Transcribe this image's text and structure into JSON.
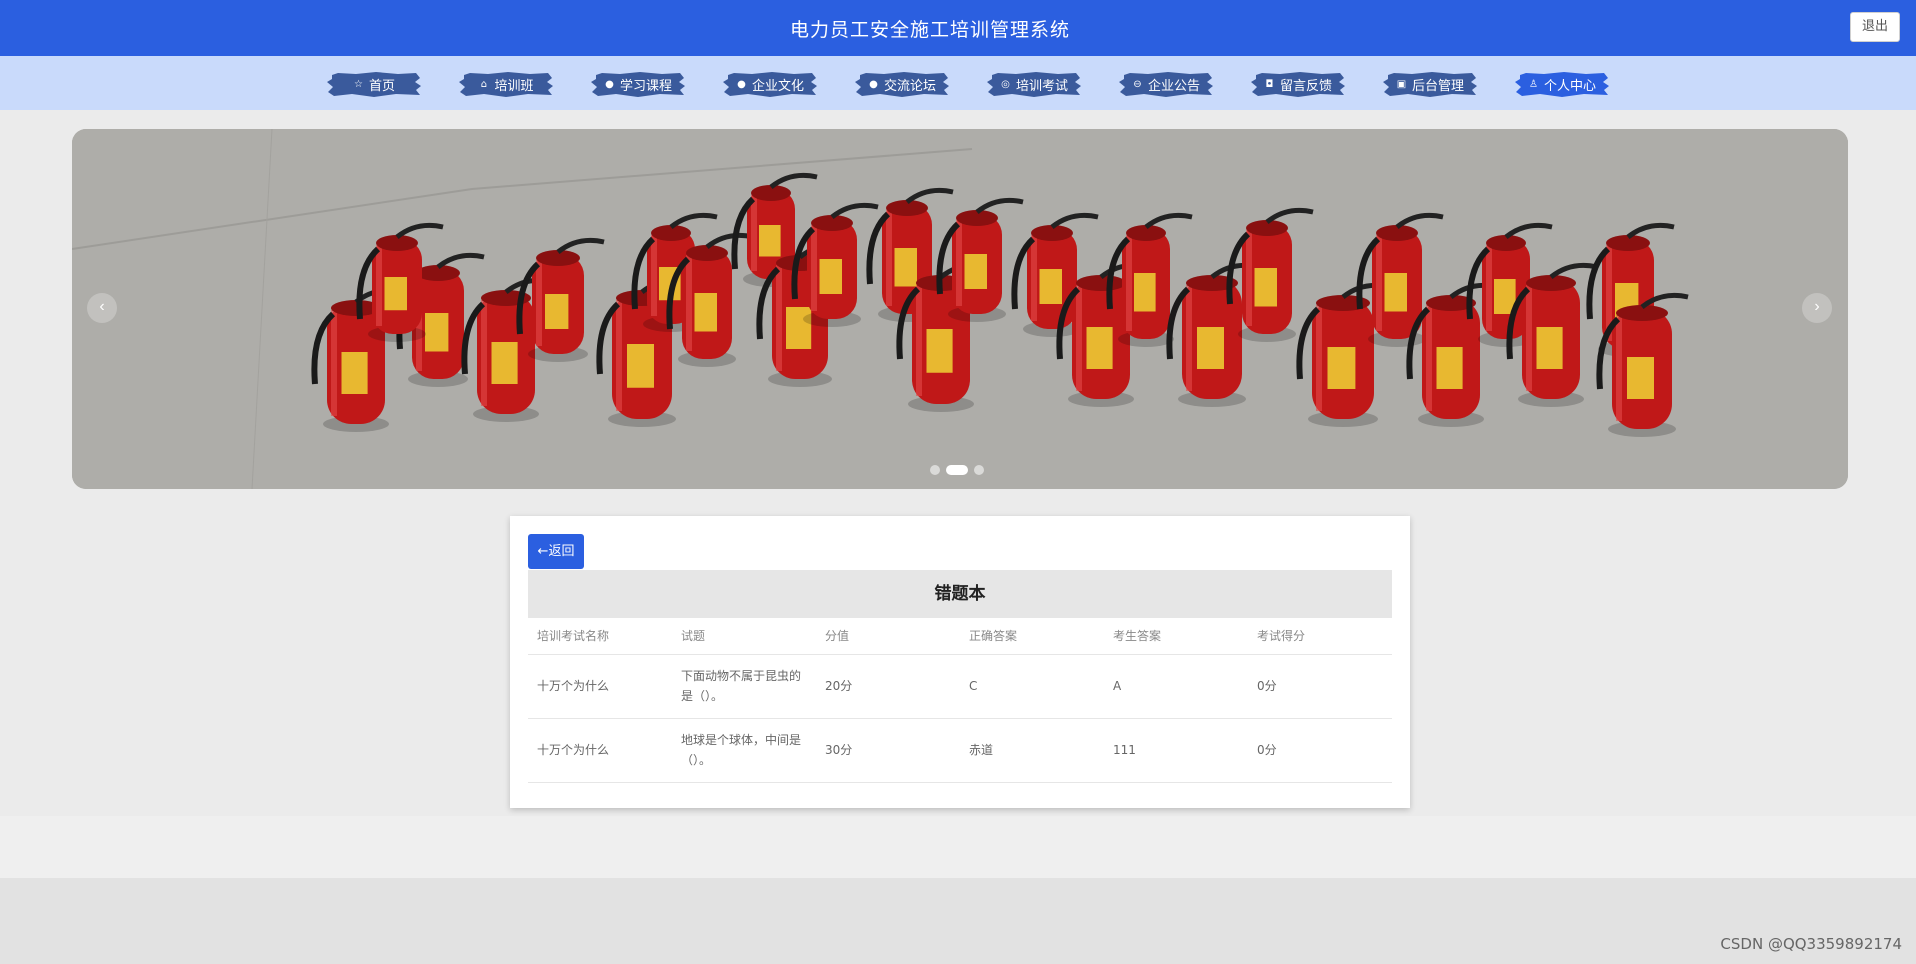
{
  "header": {
    "title": "电力员工安全施工培训管理系统",
    "logout_label": "退出"
  },
  "nav": {
    "items": [
      {
        "label": "首页",
        "icon": "star-icon",
        "glyph": "☆"
      },
      {
        "label": "培训班",
        "icon": "bag-icon",
        "glyph": "⌂"
      },
      {
        "label": "学习课程",
        "icon": "info-circle-icon",
        "glyph": "●"
      },
      {
        "label": "企业文化",
        "icon": "question-circle-icon",
        "glyph": "●"
      },
      {
        "label": "交流论坛",
        "icon": "info-circle-icon",
        "glyph": "●"
      },
      {
        "label": "培训考试",
        "icon": "target-icon",
        "glyph": "◎"
      },
      {
        "label": "企业公告",
        "icon": "minus-circle-icon",
        "glyph": "⊖"
      },
      {
        "label": "留言反馈",
        "icon": "camera-icon",
        "glyph": "◘"
      },
      {
        "label": "后台管理",
        "icon": "package-icon",
        "glyph": "▣"
      },
      {
        "label": "个人中心",
        "icon": "user-icon",
        "glyph": "♙"
      }
    ],
    "active_index": 9,
    "colors": {
      "normal": "#3a5a9c",
      "active": "#2b5fe0"
    }
  },
  "banner": {
    "prev_label": "‹",
    "next_label": "›",
    "active_slide": 1,
    "slide_count": 3
  },
  "card": {
    "back_label": "←返回",
    "title": "错题本",
    "columns": [
      "培训考试名称",
      "试题",
      "分值",
      "正确答案",
      "考生答案",
      "考试得分"
    ],
    "rows": [
      [
        "十万个为什么",
        "下面动物不属于昆虫的是（）。",
        "20分",
        "C",
        "A",
        "0分"
      ],
      [
        "十万个为什么",
        "地球是个球体，中间是（）。",
        "30分",
        "赤道",
        "111",
        "0分"
      ]
    ]
  },
  "watermark": "CSDN @QQ3359892174",
  "colors": {
    "header_bg": "#2b5fe0",
    "nav_bg": "#c9dafb",
    "accent": "#2b5fe0"
  }
}
